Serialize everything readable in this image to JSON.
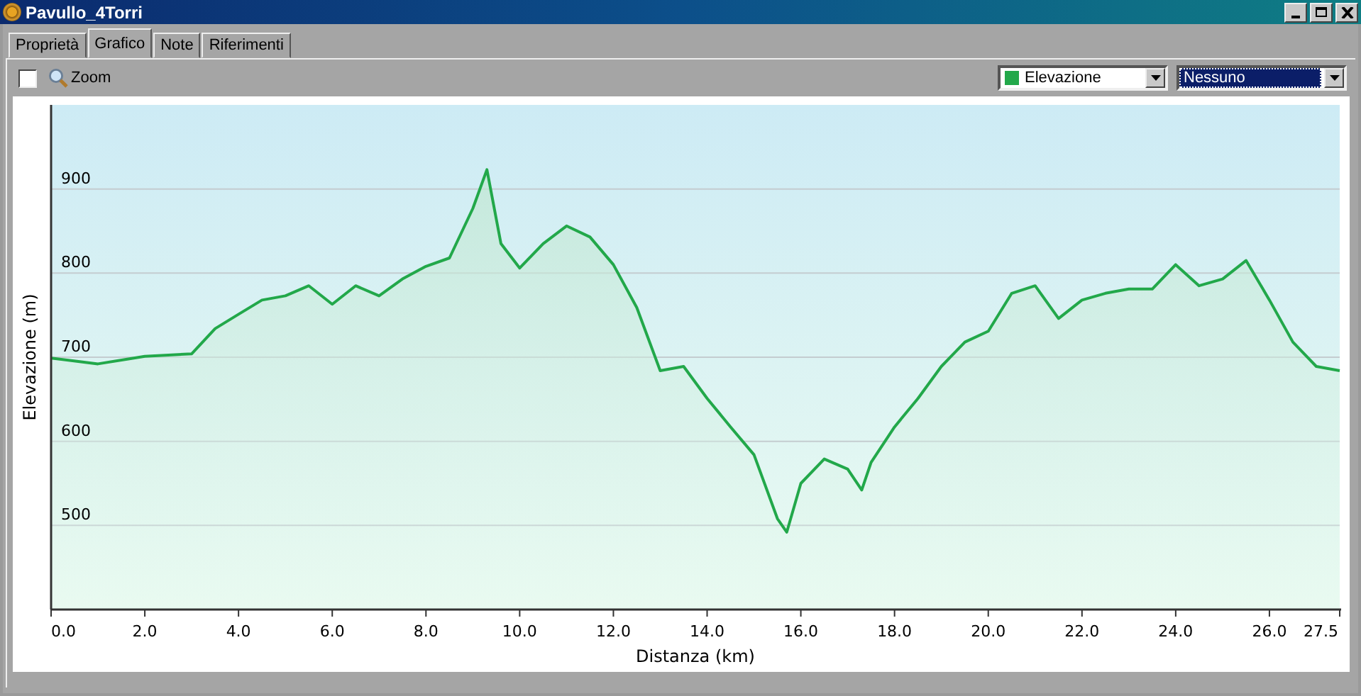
{
  "window": {
    "title": "Pavullo_4Torri"
  },
  "tabs": [
    {
      "label": "Proprietà",
      "selected": false
    },
    {
      "label": "Grafico",
      "selected": true
    },
    {
      "label": "Note",
      "selected": false
    },
    {
      "label": "Riferimenti",
      "selected": false
    }
  ],
  "toolbar": {
    "zoom": {
      "label": "Zoom",
      "checked": false
    },
    "series_select": {
      "focused": false
    },
    "overlay_select": {
      "value": "Nessuno",
      "focused": true
    }
  },
  "chart": {
    "chart_data": {
      "type": "area",
      "grid": true,
      "xlabel": "Distanza (km)",
      "ylabel": "Elevazione (m)",
      "xlim": [
        0,
        27.5
      ],
      "ylim": [
        400,
        1000
      ],
      "xticks": [
        {
          "value": 0,
          "label": "0.0"
        },
        {
          "value": 2,
          "label": "2.0"
        },
        {
          "value": 4,
          "label": "4.0"
        },
        {
          "value": 6,
          "label": "6.0"
        },
        {
          "value": 8,
          "label": "8.0"
        },
        {
          "value": 10,
          "label": "10.0"
        },
        {
          "value": 12,
          "label": "12.0"
        },
        {
          "value": 14,
          "label": "14.0"
        },
        {
          "value": 16,
          "label": "16.0"
        },
        {
          "value": 18,
          "label": "18.0"
        },
        {
          "value": 20,
          "label": "20.0"
        },
        {
          "value": 22,
          "label": "22.0"
        },
        {
          "value": 24,
          "label": "24.0"
        },
        {
          "value": 26,
          "label": "26.0"
        },
        {
          "value": 27.5,
          "label": "27.5"
        }
      ],
      "yticks": [
        500,
        600,
        700,
        800,
        900
      ],
      "x": [
        0,
        1,
        2,
        3,
        3.5,
        4,
        4.5,
        5,
        5.5,
        6,
        6.5,
        7,
        7.5,
        8,
        8.5,
        9,
        9.3,
        9.6,
        10,
        10.5,
        11,
        11.5,
        12,
        12.5,
        13,
        13.5,
        14,
        14.5,
        15,
        15.5,
        15.7,
        16,
        16.5,
        17,
        17.3,
        17.5,
        18,
        18.5,
        19,
        19.5,
        20,
        20.5,
        21,
        21.5,
        22,
        22.5,
        23,
        23.5,
        24,
        24.5,
        25,
        25.5,
        26,
        26.5,
        27,
        27.5
      ],
      "series": [
        {
          "name": "Elevazione",
          "color": "#22a84a",
          "values": [
            699,
            692,
            701,
            704,
            734,
            751,
            768,
            773,
            785,
            763,
            785,
            773,
            793,
            808,
            818,
            877,
            923,
            835,
            806,
            835,
            856,
            843,
            810,
            759,
            684,
            689,
            651,
            617,
            584,
            508,
            492,
            550,
            579,
            567,
            542,
            575,
            617,
            651,
            689,
            718,
            731,
            776,
            785,
            746,
            768,
            776,
            781,
            781,
            810,
            785,
            793,
            815,
            768,
            718,
            689,
            684
          ]
        }
      ]
    }
  }
}
